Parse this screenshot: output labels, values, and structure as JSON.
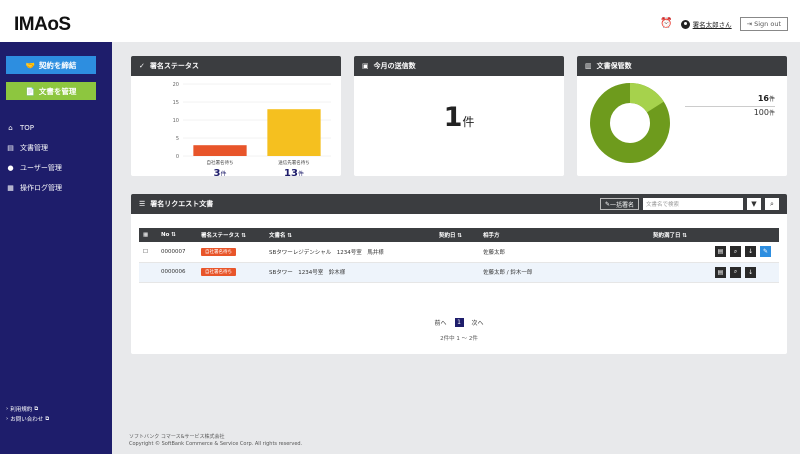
{
  "header": {
    "logo": "IMAoS",
    "user_name": "署名太郎さん",
    "signout_label": "Sign out"
  },
  "sidebar": {
    "contract_button": "契約を締結",
    "docs_button": "文書を管理",
    "nav": [
      {
        "label": "TOP",
        "icon": "home-icon"
      },
      {
        "label": "文書管理",
        "icon": "folder-icon"
      },
      {
        "label": "ユーザー管理",
        "icon": "user-icon"
      },
      {
        "label": "操作ログ管理",
        "icon": "log-icon"
      }
    ],
    "links": [
      "利用規約",
      "お問い合わせ"
    ]
  },
  "cards": {
    "status": {
      "title": "署名ステータス",
      "bars": [
        {
          "label": "自社署名待ち",
          "value": 3,
          "unit": "件",
          "color": "#e8552a"
        },
        {
          "label": "送信先署名待ち",
          "value": 13,
          "unit": "件",
          "color": "#f5c01f"
        }
      ]
    },
    "sent": {
      "title": "今月の送信数",
      "value": "1",
      "unit": "件"
    },
    "storage": {
      "title": "文書保管数",
      "used": "16",
      "total": "100",
      "unit": "件",
      "used_color": "#6e9b1d",
      "free_color": "#a6d24c"
    }
  },
  "chart_data": {
    "type": "bar",
    "categories": [
      "自社署名待ち",
      "送信先署名待ち"
    ],
    "values": [
      3,
      13
    ],
    "ylim": [
      0,
      20
    ],
    "yticks": [
      0,
      5,
      10,
      15,
      20
    ]
  },
  "requests": {
    "title": "署名リクエスト文書",
    "bulk_sign": "一括署名",
    "search_placeholder": "文書名で検索",
    "columns": [
      "No",
      "署名ステータス",
      "文書名",
      "契約日",
      "相手方",
      "契約満了日"
    ],
    "rows": [
      {
        "no": "0000007",
        "status": "自社署名待ち",
        "name": "SBタワーレジデンシャル　1234号室　馬井様",
        "date": "",
        "party": "佐藤太郎",
        "end": ""
      },
      {
        "no": "0000006",
        "status": "自社署名待ち",
        "name": "SBタワー　1234号室　鈴木様",
        "date": "",
        "party": "佐藤太郎 / 鈴木一郎",
        "end": ""
      }
    ],
    "pager": {
      "prev": "前へ",
      "current": "1",
      "next": "次へ",
      "info": "2件中 1 〜 2件"
    }
  },
  "footer": {
    "company": "ソフトバンク コマース&サービス株式会社",
    "copyright": "Copyright © SoftBank Commerce & Service Corp. All rights reserved."
  }
}
